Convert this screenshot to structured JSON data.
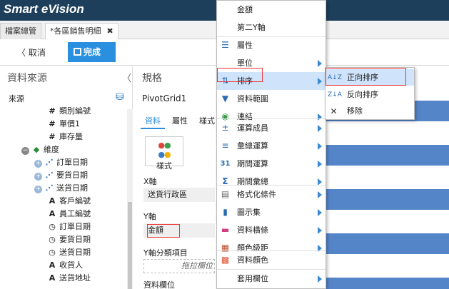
{
  "app": {
    "title": "Smart eVision"
  },
  "tabs": [
    {
      "label": "檔案總管"
    },
    {
      "label": "*各區銷售明細",
      "close": "✖"
    }
  ],
  "toolbar": {
    "cancel_label": "〈 取消",
    "done_label": "完成"
  },
  "left_pane": {
    "title": "資料來源",
    "collapse_icon": "〈",
    "source_label": "來源",
    "tree": [
      {
        "label": "類別編號",
        "icon": "#"
      },
      {
        "label": "單價1",
        "icon": "#"
      },
      {
        "label": "庫存量",
        "icon": "#"
      },
      {
        "label": "維度",
        "icon": "◆"
      },
      {
        "label": "訂單日期",
        "icon": "⋰"
      },
      {
        "label": "要貨日期",
        "icon": "⋰"
      },
      {
        "label": "送貨日期",
        "icon": "⋰"
      },
      {
        "label": "客戶編號",
        "icon": "A"
      },
      {
        "label": "員工編號",
        "icon": "A"
      },
      {
        "label": "訂單日期",
        "icon": "◷"
      },
      {
        "label": "要貨日期",
        "icon": "◷"
      },
      {
        "label": "送貨日期",
        "icon": "◷"
      },
      {
        "label": "收貨人",
        "icon": "A"
      },
      {
        "label": "送貨地址",
        "icon": "A"
      }
    ]
  },
  "main": {
    "title": "規格",
    "pivot_name": "PivotGrid1",
    "subtabs": [
      "資料",
      "屬性",
      "樣式"
    ],
    "style_button": "樣式",
    "x_axis_label": "X軸",
    "x_axis_value": "送貨行政區",
    "y_axis_label": "Y軸",
    "y_axis_value": "金額",
    "y_group_label": "Y軸分類項目",
    "drop_placeholder": "拖拉欄位",
    "data_field_label": "資料欄位"
  },
  "context_menu": {
    "items": [
      {
        "label": "金額",
        "icon": "",
        "submenu": false
      },
      {
        "label": "第二Y軸",
        "icon": "",
        "submenu": false
      },
      {
        "label": "屬性",
        "icon": "☰",
        "submenu": false
      },
      {
        "label": "單位",
        "icon": "",
        "submenu": true
      },
      {
        "label": "排序",
        "icon": "⇅",
        "submenu": true
      },
      {
        "label": "資料範圍",
        "icon": "▼",
        "submenu": false
      },
      {
        "label": "連結",
        "icon": "◉",
        "submenu": true
      },
      {
        "label": "運算成員",
        "icon": "±",
        "submenu": true
      },
      {
        "label": "彙總運算",
        "icon": "≡",
        "submenu": true
      },
      {
        "label": "期間運算",
        "icon": "31",
        "submenu": true
      },
      {
        "label": "期間彙總",
        "icon": "Σ",
        "submenu": true
      },
      {
        "label": "格式化條件",
        "icon": "▤",
        "submenu": true
      },
      {
        "label": "圖示集",
        "icon": "▮",
        "submenu": true
      },
      {
        "label": "資料橫條",
        "icon": "▬",
        "submenu": true
      },
      {
        "label": "顏色級距",
        "icon": "▦",
        "submenu": true
      },
      {
        "label": "資料顏色",
        "icon": "▩",
        "submenu": false
      },
      {
        "label": "套用欄位",
        "icon": "",
        "submenu": true
      }
    ]
  },
  "sort_submenu": {
    "items": [
      {
        "label": "正向排序",
        "icon": "A↓Z"
      },
      {
        "label": "反向排序",
        "icon": "Z↓A"
      },
      {
        "label": "移除",
        "icon": "✕"
      }
    ]
  },
  "colors": {
    "accent": "#2b8fe0",
    "titlebar": "#1e3f5c",
    "bar": "#5585c9",
    "highlight": "#e33333"
  }
}
